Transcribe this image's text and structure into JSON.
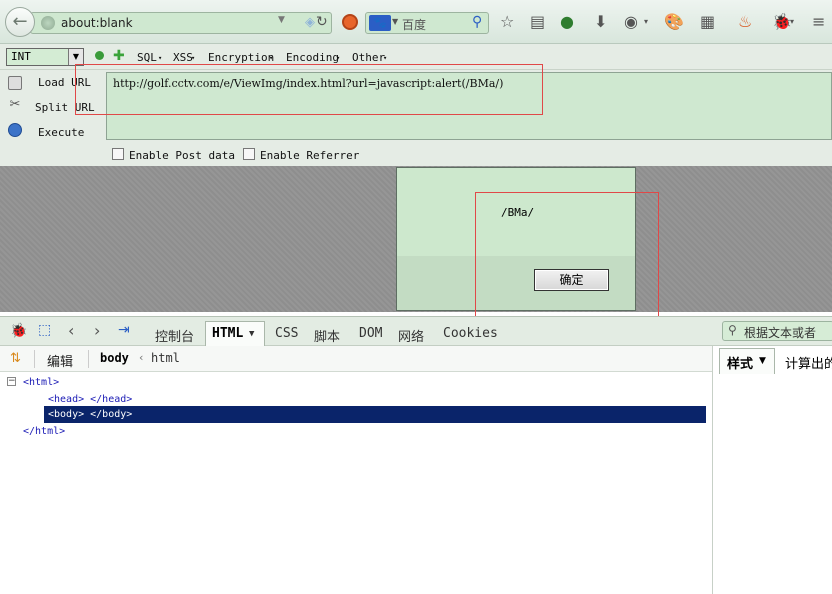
{
  "browser": {
    "address": "about:blank",
    "search_engine": "百度"
  },
  "hackbar": {
    "type_select": "INT",
    "menus": [
      "SQL",
      "XSS",
      "Encryption",
      "Encoding",
      "Other"
    ],
    "load_url": "Load URL",
    "split_url": "Split URL",
    "execute": "Execute",
    "url_value": "http://golf.cctv.com/e/ViewImg/index.html?url=javascript:alert(/BMa/)",
    "enable_post": "Enable Post data",
    "enable_referrer": "Enable Referrer"
  },
  "alert": {
    "message": "/BMa/",
    "ok_label": "确定"
  },
  "firebug": {
    "tabs": [
      "控制台",
      "HTML",
      "CSS",
      "脚本",
      "DOM",
      "网络",
      "Cookies"
    ],
    "active_tab": "HTML",
    "search_placeholder": "根据文本或者",
    "edit_label": "编辑",
    "breadcrumb_body": "body",
    "breadcrumb_html": "html",
    "side_tabs": [
      "样式",
      "计算出的"
    ],
    "tree": [
      "<html>",
      "<head> </head>",
      "<body> </body>",
      "</html>"
    ]
  },
  "colors": {
    "field_bg": "#cfe8d0",
    "selection": "#0a246a",
    "highlight_box": "#e04848"
  }
}
